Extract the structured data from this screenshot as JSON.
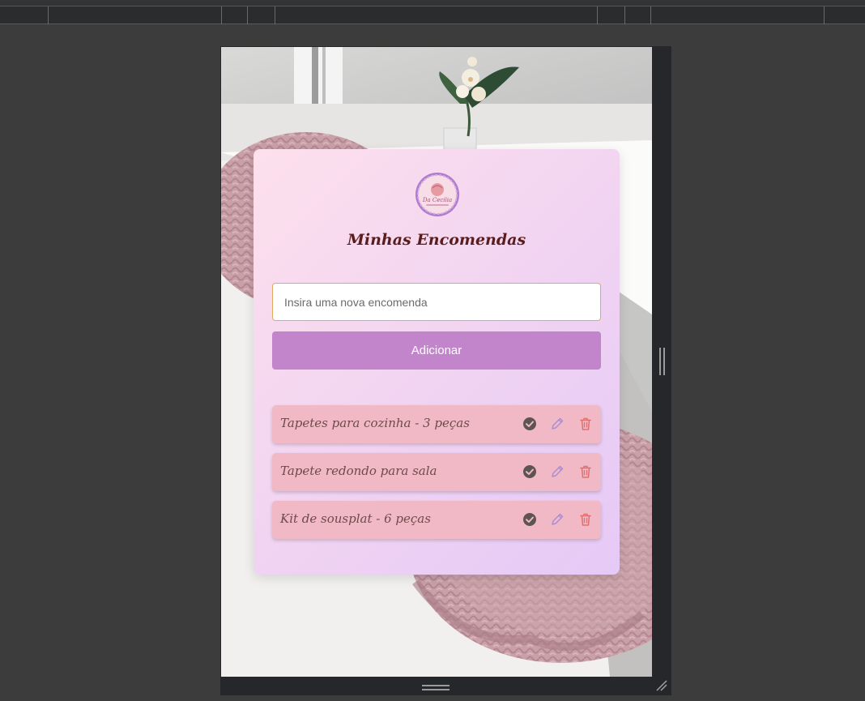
{
  "page": {
    "title": "Minhas Encomendas"
  },
  "logo": {
    "text": "Da Cecilia"
  },
  "form": {
    "placeholder": "Insira uma nova encomenda",
    "value": "",
    "add_label": "Adicionar"
  },
  "orders": [
    {
      "text": "Tapetes para cozinha - 3 peças"
    },
    {
      "text": "Tapete redondo para sala"
    },
    {
      "text": "Kit de sousplat - 6 peças"
    }
  ],
  "icons": {
    "complete": "check-circle-icon",
    "edit": "pencil-icon",
    "delete": "trash-icon"
  },
  "colors": {
    "button": "#c285cc",
    "item": "#f1b9c6",
    "title": "#5a1c1c",
    "delete": "#e07070",
    "edit": "#a98ed0",
    "check": "#5e5454"
  }
}
